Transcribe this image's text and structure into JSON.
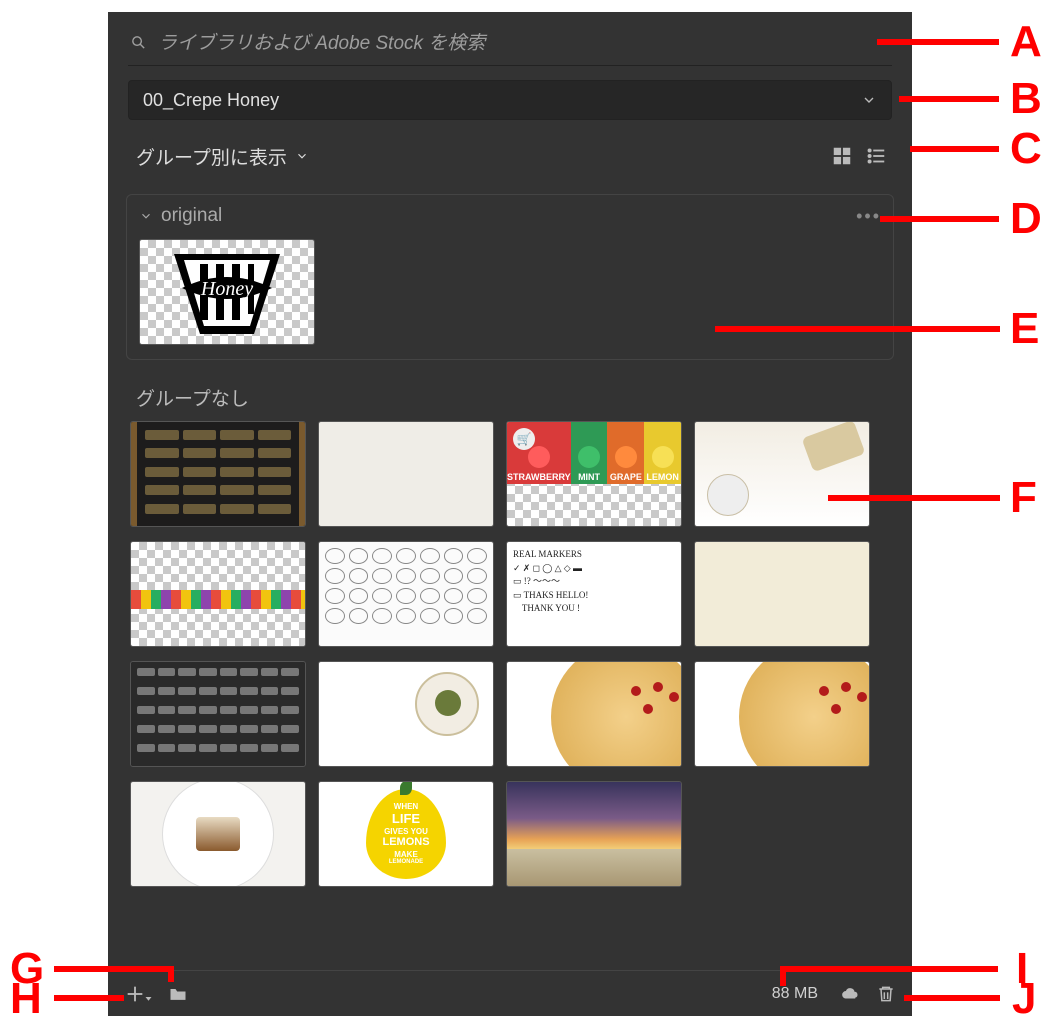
{
  "search": {
    "placeholder": "ライブラリおよび Adobe Stock を検索"
  },
  "library_dropdown": {
    "selected": "00_Crepe Honey"
  },
  "view": {
    "group_by_label": "グループ別に表示"
  },
  "groups": {
    "original": {
      "name": "original"
    },
    "ungrouped_label": "グループなし"
  },
  "ungrouped_items": [
    {
      "id": "menu-board"
    },
    {
      "id": "paper-texture"
    },
    {
      "id": "flavors",
      "flavor_labels": [
        "STRAWBERRY",
        "MINT",
        "GRAPE",
        "LEMON"
      ]
    },
    {
      "id": "flour"
    },
    {
      "id": "fruit-line"
    },
    {
      "id": "icon-sheet"
    },
    {
      "id": "real-markers",
      "text": "REAL MARKERS\n✓ ✗ ◻ ◯ △ ◇ ▬\n▭ !? ～～～\n▭ THAKS HELLO!\n    THANK YOU !"
    },
    {
      "id": "beige-paper"
    },
    {
      "id": "chalk-doodles"
    },
    {
      "id": "herbs-plate"
    },
    {
      "id": "crepe-plate-1"
    },
    {
      "id": "crepe-plate-2"
    },
    {
      "id": "cake-slice"
    },
    {
      "id": "lemon-poster",
      "lines": [
        "WHEN",
        "LIFE",
        "GIVES YOU",
        "LEMONS",
        "MAKE",
        "LEMONADE"
      ]
    },
    {
      "id": "sunset-beach"
    }
  ],
  "footer": {
    "size": "88 MB"
  },
  "callouts": [
    "A",
    "B",
    "C",
    "D",
    "E",
    "F",
    "G",
    "H",
    "I",
    "J"
  ]
}
